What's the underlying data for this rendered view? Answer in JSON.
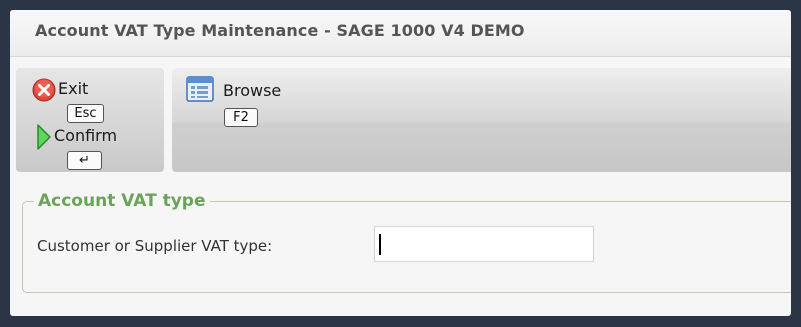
{
  "window": {
    "title": "Account VAT Type Maintenance - SAGE 1000 V4 DEMO"
  },
  "toolbar": {
    "exit": {
      "label": "Exit",
      "shortcut": "Esc",
      "icon": "exit-icon"
    },
    "confirm": {
      "label": "Confirm",
      "shortcut": "↵",
      "icon": "confirm-icon"
    },
    "browse": {
      "label": "Browse",
      "shortcut": "F2",
      "icon": "browse-icon"
    }
  },
  "form": {
    "section_title": "Account VAT type",
    "fields": [
      {
        "label": "Customer or Supplier VAT type:",
        "value": ""
      }
    ]
  },
  "colors": {
    "frame": "#2b3546",
    "section_title": "#6aa45a",
    "section_border": "#b7cfa8",
    "exit_icon": "#e0463a",
    "confirm_icon": "#3aa63a"
  }
}
